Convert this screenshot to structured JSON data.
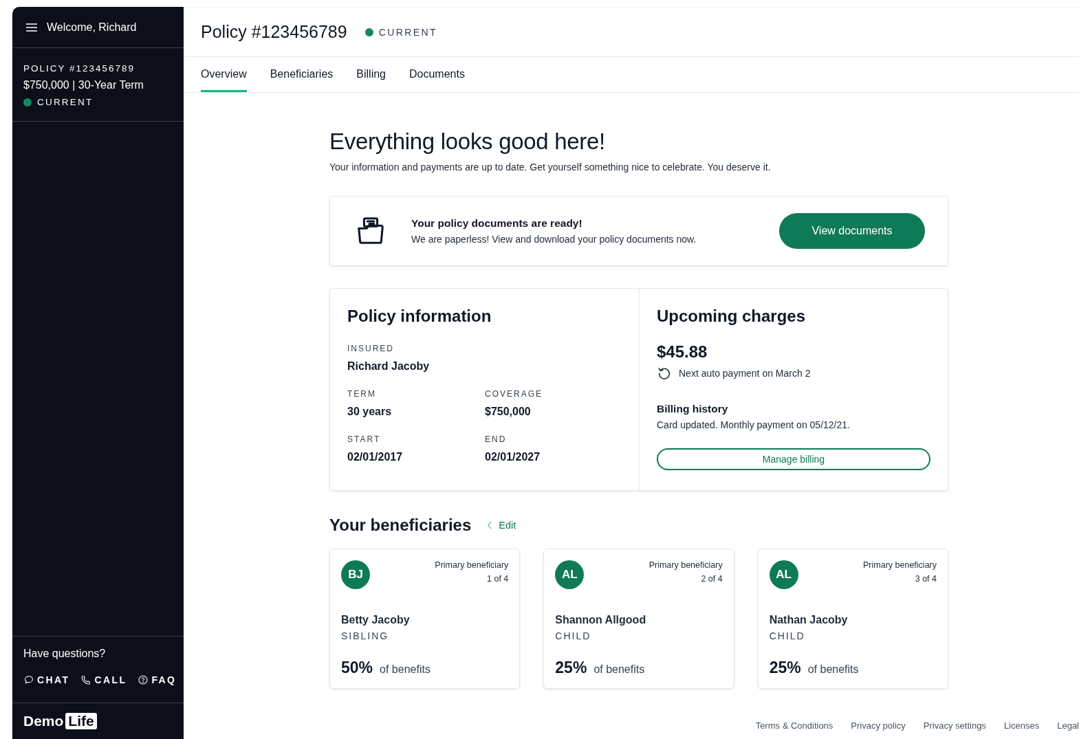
{
  "sidebar": {
    "greeting": "Welcome, Richard",
    "policy_label": "POLICY #123456789",
    "policy_summary": "$750,000 | 30-Year Term",
    "status": "CURRENT",
    "help_title": "Have questions?",
    "help_links": [
      {
        "kind": "chat",
        "label": "CHAT"
      },
      {
        "kind": "call",
        "label": "CALL"
      },
      {
        "kind": "faq",
        "label": "FAQ"
      }
    ],
    "logo": {
      "word": "Demo",
      "boxed": "Life"
    }
  },
  "header": {
    "title": "Policy #123456789",
    "status": "CURRENT"
  },
  "tabs": [
    {
      "label": "Overview",
      "selected": true
    },
    {
      "label": "Beneficiaries",
      "selected": false
    },
    {
      "label": "Billing",
      "selected": false
    },
    {
      "label": "Documents",
      "selected": false
    }
  ],
  "hero": {
    "title": "Everything looks good here!",
    "text": "Your information and payments are up to date. Get yourself something nice to celebrate. You deserve it."
  },
  "documents_banner": {
    "title": "Your policy documents are ready!",
    "text": "We are paperless! View and download your policy documents now.",
    "button": "View documents"
  },
  "policy_information": {
    "title": "Policy information",
    "fields": [
      {
        "label": "INSURED",
        "value": "Richard Jacoby"
      },
      {
        "label": "TERM",
        "value": "30 years"
      },
      {
        "label": "COVERAGE",
        "value": "$750,000"
      },
      {
        "label": "START",
        "value": "02/01/2017"
      },
      {
        "label": "END",
        "value": "02/01/2027"
      }
    ]
  },
  "upcoming_charges": {
    "title": "Upcoming charges",
    "amount": "$45.88",
    "next_payment": "Next auto payment on March 2",
    "history_title": "Billing history",
    "history_text": "Card updated. Monthly payment on 05/12/21.",
    "button": "Manage billing"
  },
  "beneficiaries": {
    "title": "Your beneficiaries",
    "edit": "Edit",
    "items": [
      {
        "initials": "BJ",
        "role": "Primary beneficiary",
        "position": "1 of 4",
        "name": "Betty Jacoby",
        "relation": "SIBLING",
        "share": "50%",
        "share_label": "of benefits"
      },
      {
        "initials": "AL",
        "role": "Primary beneficiary",
        "position": "2 of 4",
        "name": "Shannon Allgood",
        "relation": "CHILD",
        "share": "25%",
        "share_label": "of benefits"
      },
      {
        "initials": "AL",
        "role": "Primary beneficiary",
        "position": "3 of 4",
        "name": "Nathan Jacoby",
        "relation": "CHILD",
        "share": "25%",
        "share_label": "of benefits"
      }
    ]
  },
  "footer_links": [
    "Terms & Conditions",
    "Privacy policy",
    "Privacy settings",
    "Licenses",
    "Legal"
  ]
}
